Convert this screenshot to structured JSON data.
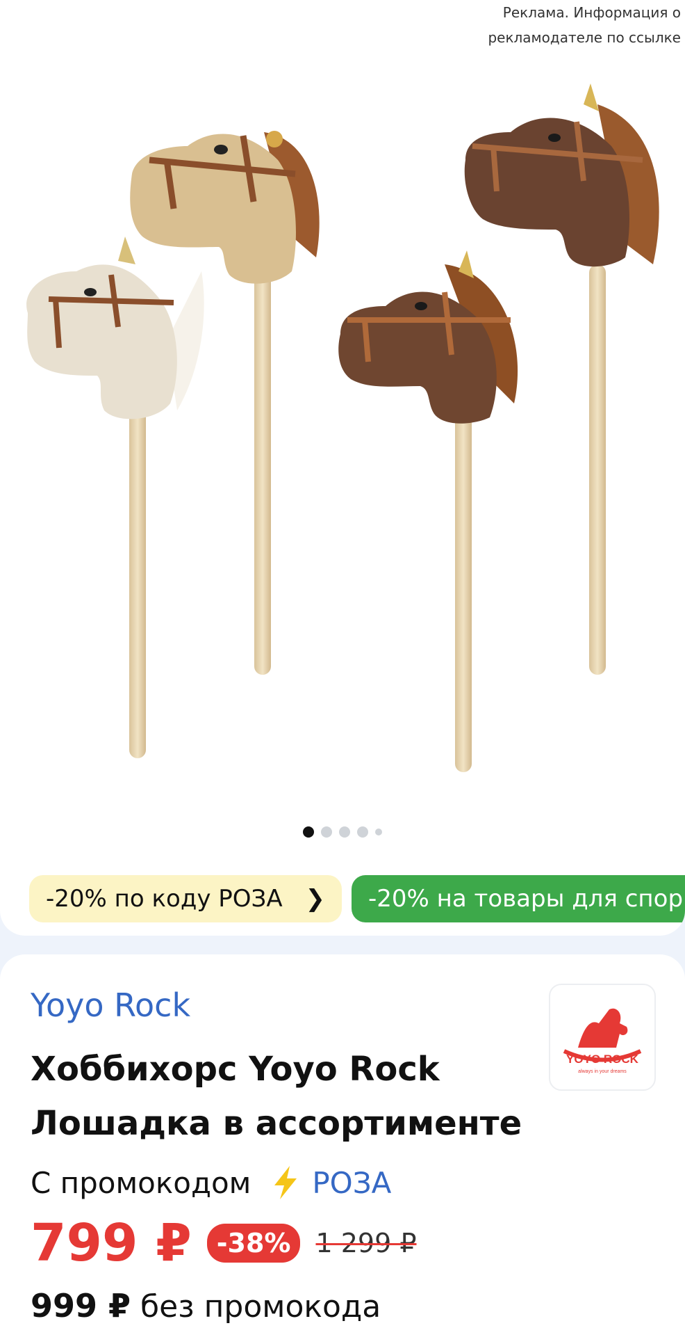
{
  "ad_notice": {
    "line1": "Реклама. Информация о",
    "line2": "рекламодателе по ссылке"
  },
  "gallery": {
    "image_alt": "hobby horse toys",
    "dots_count": 5,
    "active_index": 0
  },
  "promos": [
    {
      "label": "-20% по коду РОЗА",
      "color": "#fcf4c5"
    },
    {
      "label": "-20% на товары для спор",
      "color": "#3da94a"
    }
  ],
  "product": {
    "brand": "Yoyo Rock",
    "title": "Хоббихорс Yoyo Rock Лошадка в ассортименте",
    "logo_text": "YOYO ROCK",
    "logo_tagline": "always in your dreams",
    "promo_prefix": "С промокодом",
    "promo_code": "РОЗА",
    "price": "799 ₽",
    "discount": "-38%",
    "old_price": "1 299 ₽",
    "price_without_promo": "999 ₽",
    "without_promo_label": "без промокода"
  },
  "colors": {
    "accent_red": "#e53935",
    "brand_blue": "#3568c4",
    "promo_green": "#3da94a",
    "promo_yellow": "#fcf4c5"
  }
}
